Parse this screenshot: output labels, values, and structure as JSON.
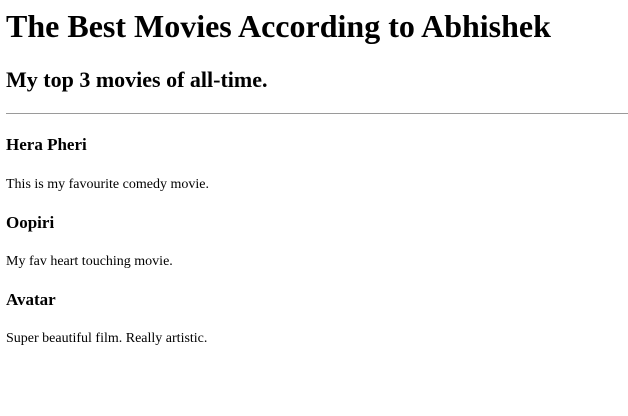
{
  "page": {
    "title": "The Best Movies According to Abhishek",
    "subtitle": "My top 3 movies of all-time."
  },
  "movies": [
    {
      "title": "Hera Pheri",
      "description": "This is my favourite comedy movie."
    },
    {
      "title": "Oopiri",
      "description": "My fav heart touching movie."
    },
    {
      "title": "Avatar",
      "description": "Super beautiful film. Really artistic."
    }
  ]
}
